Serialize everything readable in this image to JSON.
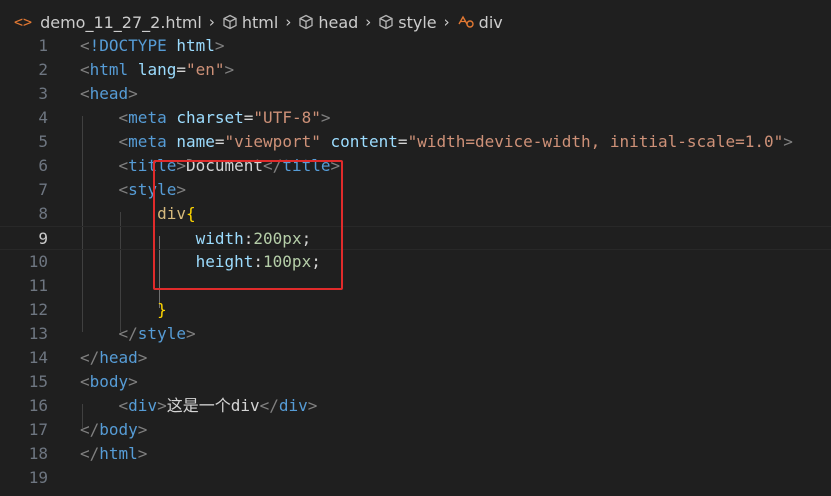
{
  "breadcrumb": {
    "file": "demo_11_27_2.html",
    "items": [
      "html",
      "head",
      "style",
      "div"
    ]
  },
  "lines": [
    {
      "n": "1",
      "segs": [
        [
          "punc",
          "<"
        ],
        [
          "tag",
          "!DOCTYPE"
        ],
        [
          "txt",
          " "
        ],
        [
          "attr",
          "html"
        ],
        [
          "punc",
          ">"
        ]
      ]
    },
    {
      "n": "2",
      "segs": [
        [
          "punc",
          "<"
        ],
        [
          "tag",
          "html"
        ],
        [
          "txt",
          " "
        ],
        [
          "attr",
          "lang"
        ],
        [
          "txt",
          "="
        ],
        [
          "str",
          "\"en\""
        ],
        [
          "punc",
          ">"
        ]
      ]
    },
    {
      "n": "3",
      "segs": [
        [
          "punc",
          "<"
        ],
        [
          "tag",
          "head"
        ],
        [
          "punc",
          ">"
        ]
      ]
    },
    {
      "n": "4",
      "segs": [
        [
          "txt",
          "    "
        ],
        [
          "punc",
          "<"
        ],
        [
          "tag",
          "meta"
        ],
        [
          "txt",
          " "
        ],
        [
          "attr",
          "charset"
        ],
        [
          "txt",
          "="
        ],
        [
          "str",
          "\"UTF-8\""
        ],
        [
          "punc",
          ">"
        ]
      ]
    },
    {
      "n": "5",
      "segs": [
        [
          "txt",
          "    "
        ],
        [
          "punc",
          "<"
        ],
        [
          "tag",
          "meta"
        ],
        [
          "txt",
          " "
        ],
        [
          "attr",
          "name"
        ],
        [
          "txt",
          "="
        ],
        [
          "str",
          "\"viewport\""
        ],
        [
          "txt",
          " "
        ],
        [
          "attr",
          "content"
        ],
        [
          "txt",
          "="
        ],
        [
          "str",
          "\"width=device-width, initial-scale=1.0\""
        ],
        [
          "punc",
          ">"
        ]
      ]
    },
    {
      "n": "6",
      "segs": [
        [
          "txt",
          "    "
        ],
        [
          "punc",
          "<"
        ],
        [
          "tag",
          "title"
        ],
        [
          "punc",
          ">"
        ],
        [
          "txt",
          "Document"
        ],
        [
          "punc",
          "</"
        ],
        [
          "tag",
          "title"
        ],
        [
          "punc",
          ">"
        ]
      ]
    },
    {
      "n": "7",
      "segs": [
        [
          "txt",
          "    "
        ],
        [
          "punc",
          "<"
        ],
        [
          "tag",
          "style"
        ],
        [
          "punc",
          ">"
        ]
      ]
    },
    {
      "n": "8",
      "segs": [
        [
          "txt",
          "        "
        ],
        [
          "sel",
          "div"
        ],
        [
          "brace",
          "{"
        ]
      ]
    },
    {
      "n": "9",
      "segs": [
        [
          "txt",
          "            "
        ],
        [
          "prop",
          "width"
        ],
        [
          "txt",
          ":"
        ],
        [
          "num",
          "200px"
        ],
        [
          "txt",
          ";"
        ]
      ]
    },
    {
      "n": "10",
      "segs": [
        [
          "txt",
          "            "
        ],
        [
          "prop",
          "height"
        ],
        [
          "txt",
          ":"
        ],
        [
          "num",
          "100px"
        ],
        [
          "txt",
          ";"
        ]
      ]
    },
    {
      "n": "11",
      "segs": []
    },
    {
      "n": "12",
      "segs": [
        [
          "txt",
          "        "
        ],
        [
          "brace",
          "}"
        ]
      ]
    },
    {
      "n": "13",
      "segs": [
        [
          "txt",
          "    "
        ],
        [
          "punc",
          "</"
        ],
        [
          "tag",
          "style"
        ],
        [
          "punc",
          ">"
        ]
      ]
    },
    {
      "n": "14",
      "segs": [
        [
          "punc",
          "</"
        ],
        [
          "tag",
          "head"
        ],
        [
          "punc",
          ">"
        ]
      ]
    },
    {
      "n": "15",
      "segs": [
        [
          "punc",
          "<"
        ],
        [
          "tag",
          "body"
        ],
        [
          "punc",
          ">"
        ]
      ]
    },
    {
      "n": "16",
      "segs": [
        [
          "txt",
          "    "
        ],
        [
          "punc",
          "<"
        ],
        [
          "tag",
          "div"
        ],
        [
          "punc",
          ">"
        ],
        [
          "txt",
          "这是一个div"
        ],
        [
          "punc",
          "</"
        ],
        [
          "tag",
          "div"
        ],
        [
          "punc",
          ">"
        ]
      ]
    },
    {
      "n": "17",
      "segs": [
        [
          "punc",
          "</"
        ],
        [
          "tag",
          "body"
        ],
        [
          "punc",
          ">"
        ]
      ]
    },
    {
      "n": "18",
      "segs": [
        [
          "punc",
          "</"
        ],
        [
          "tag",
          "html"
        ],
        [
          "punc",
          ">"
        ]
      ]
    },
    {
      "n": "19",
      "segs": []
    }
  ],
  "active_line": "9",
  "colors": {
    "background": "#1f1f1f",
    "highlight_box": "#e02b2b"
  }
}
